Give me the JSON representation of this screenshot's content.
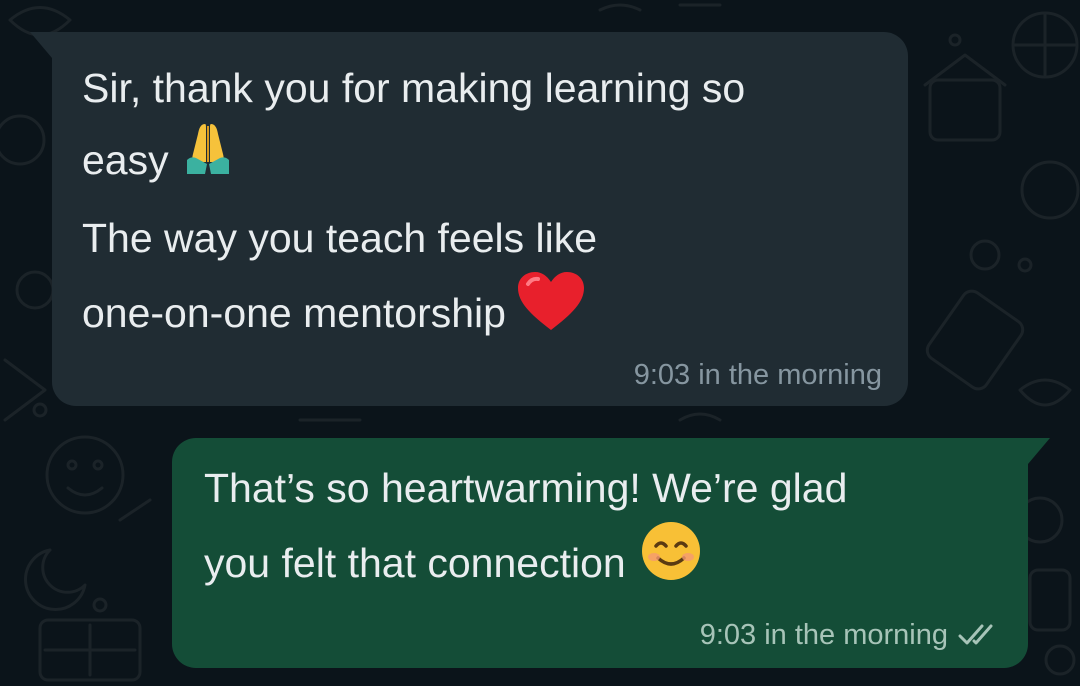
{
  "chat": {
    "messages": [
      {
        "direction": "incoming",
        "lines": [
          "Sir, thank you for making learning so",
          "easy",
          "The way you teach feels like",
          "one-on-one mentorship"
        ],
        "emojis": [
          "folded-hands-icon",
          "red-heart-icon"
        ],
        "time": "9:03 in the morning",
        "bubble_color": "#202c33"
      },
      {
        "direction": "outgoing",
        "lines": [
          "That’s so heartwarming! We’re glad",
          "you felt that connection"
        ],
        "emojis": [
          "smiling-face-icon"
        ],
        "time": "9:03 in the morning",
        "status": "read",
        "status_icon": "double-check-icon",
        "bubble_color": "#144d37"
      }
    ],
    "colors": {
      "background": "#0b141a",
      "text": "#e9edef",
      "meta_incoming": "#8696a0",
      "meta_outgoing": "#a7c4b8"
    }
  }
}
